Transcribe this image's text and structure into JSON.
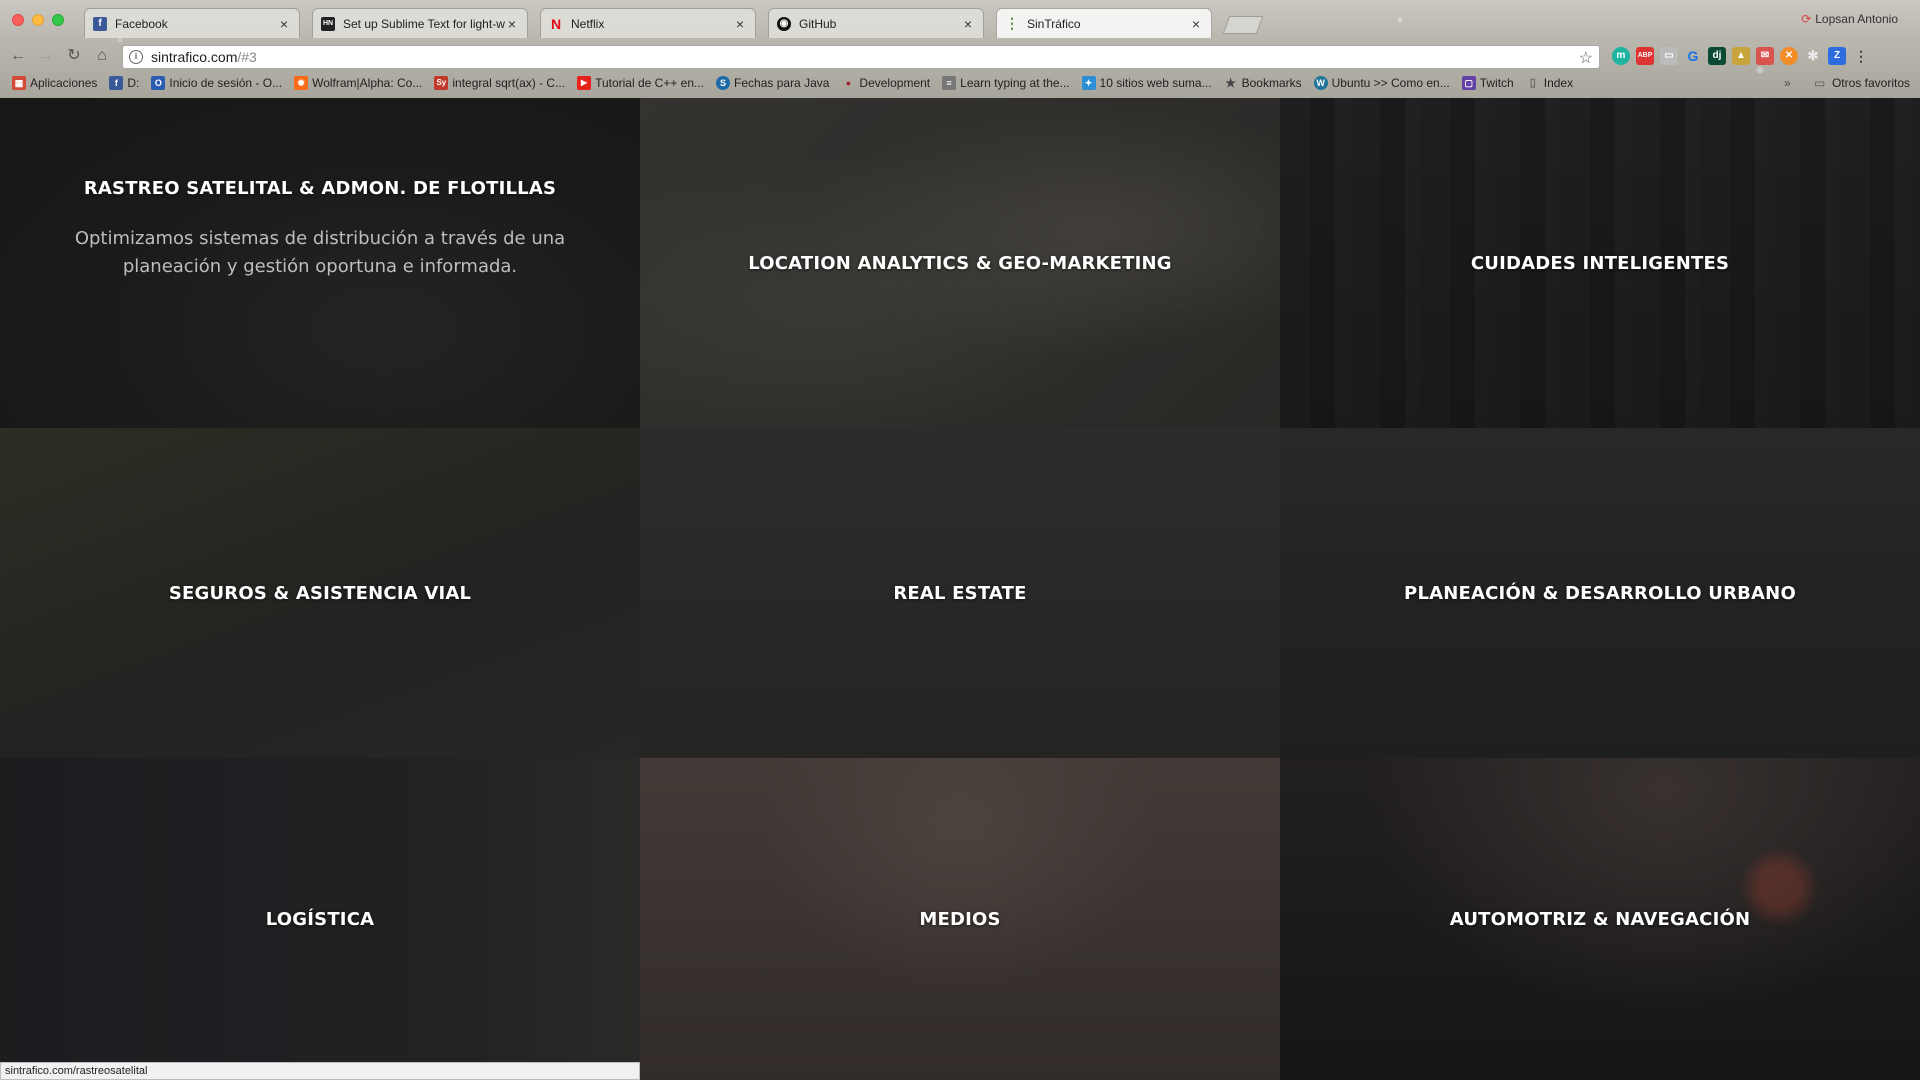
{
  "browser": {
    "tabs": [
      {
        "title": "Facebook",
        "icon": "facebook-icon",
        "color": "#3b5998",
        "glyph": "f"
      },
      {
        "title": "Set up Sublime Text for light-w",
        "icon": "hacker-news-icon",
        "color": "#222222",
        "glyph": "HN"
      },
      {
        "title": "Netflix",
        "icon": "netflix-icon",
        "color": "#e50914",
        "glyph": "N"
      },
      {
        "title": "GitHub",
        "icon": "github-icon",
        "color": "#111111",
        "glyph": "◉"
      },
      {
        "title": "SinTráfico",
        "icon": "sintrafico-icon",
        "color": "#4a8a3a",
        "glyph": "⋮"
      }
    ],
    "profile_name": "Lopsan Antonio",
    "url_host": "sintrafico.com",
    "url_path": "/#3",
    "bookmarks": [
      {
        "label": "Aplicaciones",
        "icon": "apps-icon",
        "color": "#d34836",
        "glyph": "▦"
      },
      {
        "label": "D:",
        "icon": "facebook-icon",
        "color": "#3b5998",
        "glyph": "f"
      },
      {
        "label": "Inicio de sesión - O...",
        "icon": "login-icon",
        "color": "#2a5db0",
        "glyph": "O"
      },
      {
        "label": "Wolfram|Alpha: Co...",
        "icon": "wolfram-icon",
        "color": "#f96b17",
        "glyph": "✹"
      },
      {
        "label": "integral sqrt(ax) - C...",
        "icon": "symbolab-icon",
        "color": "#c0392b",
        "glyph": "Sy"
      },
      {
        "label": "Tutorial de C++ en...",
        "icon": "youtube-icon",
        "color": "#e62117",
        "glyph": "▶"
      },
      {
        "label": "Fechas para Java",
        "icon": "site-icon",
        "color": "#1c6aa8",
        "glyph": "S"
      },
      {
        "label": "Development",
        "icon": "development-icon",
        "color": "#a4252f",
        "glyph": "●"
      },
      {
        "label": "Learn typing at the...",
        "icon": "page-icon",
        "color": "#777777",
        "glyph": "≡"
      },
      {
        "label": "10 sitios web suma...",
        "icon": "site-icon",
        "color": "#2c8fd6",
        "glyph": "✦"
      },
      {
        "label": "Bookmarks",
        "icon": "star-icon",
        "color": "#444444",
        "glyph": "★"
      },
      {
        "label": "Ubuntu >> Como en...",
        "icon": "wordpress-icon",
        "color": "#21759b",
        "glyph": "W"
      },
      {
        "label": "Twitch",
        "icon": "twitch-icon",
        "color": "#6441a5",
        "glyph": "▢"
      },
      {
        "label": "Index",
        "icon": "document-icon",
        "color": "#888888",
        "glyph": "▯"
      }
    ],
    "other_bookmarks": "Otros favoritos",
    "more_glyph": "»"
  },
  "tiles": [
    {
      "title": "RASTREO SATELITAL & ADMON. DE FLOTILLAS",
      "description": "Optimizamos sistemas de distribución a través de una planeación y gestión oportuna e informada."
    },
    {
      "title": "LOCATION ANALYTICS & GEO-MARKETING"
    },
    {
      "title": "CUIDADES INTELIGENTES"
    },
    {
      "title": "SEGUROS & ASISTENCIA VIAL"
    },
    {
      "title": "REAL ESTATE"
    },
    {
      "title": "PLANEACIÓN & DESARROLLO URBANO"
    },
    {
      "title": "LOGÍSTICA"
    },
    {
      "title": "MEDIOS"
    },
    {
      "title": "AUTOMOTRIZ & NAVEGACIÓN"
    }
  ],
  "status_url": "sintrafico.com/rastreosatelital"
}
